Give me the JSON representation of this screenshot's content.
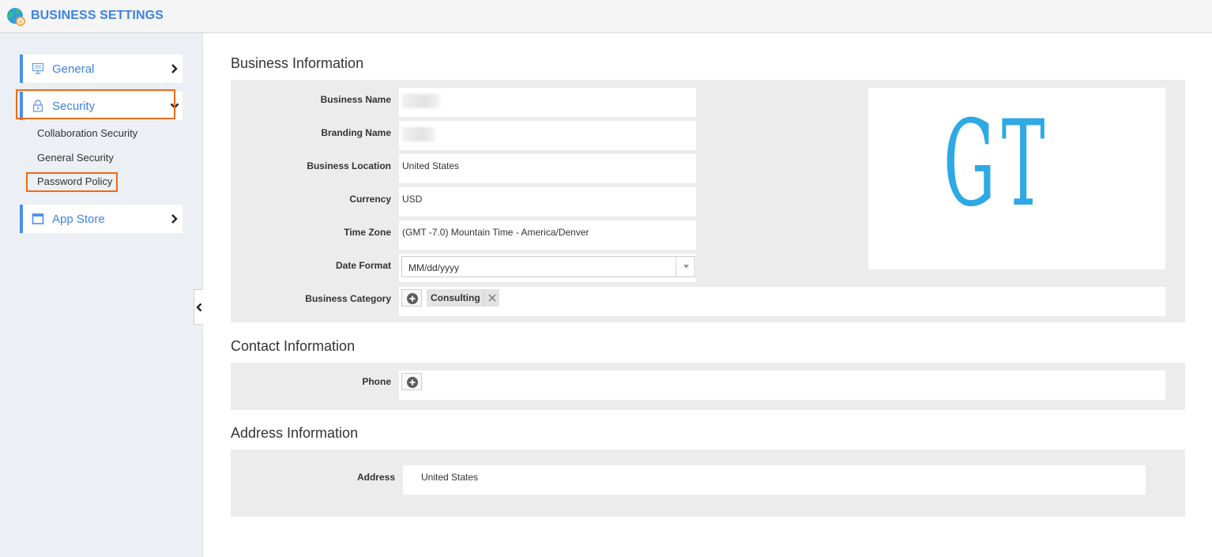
{
  "app": {
    "title": "BUSINESS SETTINGS",
    "logo_icon": "globe-gear-icon",
    "accent_color": "#3b82e8",
    "highlight_color": "#f06a14"
  },
  "sidebar": {
    "items": [
      {
        "label": "General",
        "icon": "monitor-icon",
        "chevron": "chevron-right-icon",
        "expanded": false
      },
      {
        "label": "Security",
        "icon": "lock-icon",
        "chevron": "chevron-down-icon",
        "expanded": true,
        "subitems": [
          {
            "label": "Collaboration Security"
          },
          {
            "label": "General Security"
          },
          {
            "label": "Password Policy"
          }
        ]
      },
      {
        "label": "App Store",
        "icon": "window-icon",
        "chevron": "chevron-right-icon",
        "expanded": false
      }
    ],
    "collapse_icon": "chevron-left-icon"
  },
  "business_information": {
    "title": "Business Information",
    "fields": {
      "business_name": {
        "label": "Business Name",
        "value": ""
      },
      "branding_name": {
        "label": "Branding Name",
        "value": ""
      },
      "business_location": {
        "label": "Business Location",
        "value": "United States"
      },
      "currency": {
        "label": "Currency",
        "value": "USD"
      },
      "time_zone": {
        "label": "Time Zone",
        "value": "(GMT -7.0) Mountain Time - America/Denver"
      },
      "date_format": {
        "label": "Date Format",
        "value": "MM/dd/yyyy"
      },
      "business_category": {
        "label": "Business Category",
        "tags": [
          "Consulting"
        ]
      }
    },
    "logo": {
      "text": "GT",
      "color": "#2ea9e4"
    }
  },
  "contact_information": {
    "title": "Contact Information",
    "phone": {
      "label": "Phone"
    }
  },
  "address_information": {
    "title": "Address Information",
    "address": {
      "label": "Address",
      "value": "United States"
    }
  }
}
